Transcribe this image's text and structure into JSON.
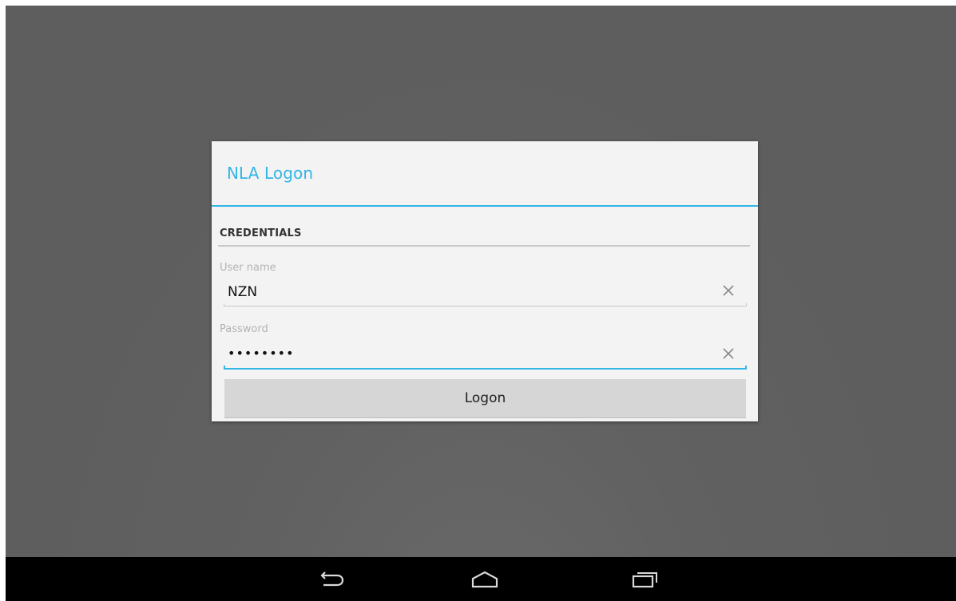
{
  "dialog": {
    "title": "NLA Logon",
    "section_header": "CREDENTIALS",
    "username": {
      "label": "User name",
      "value": "NZN"
    },
    "password": {
      "label": "Password",
      "value": "••••••••"
    },
    "logon_label": "Logon"
  },
  "colors": {
    "accent": "#33b5e5",
    "background": "#5f5f5f",
    "dialog": "#f3f3f3",
    "button": "#d6d6d6",
    "navbar": "#000000"
  },
  "icons": {
    "clear": "close-icon",
    "nav": [
      "back-icon",
      "home-icon",
      "recent-apps-icon"
    ]
  }
}
